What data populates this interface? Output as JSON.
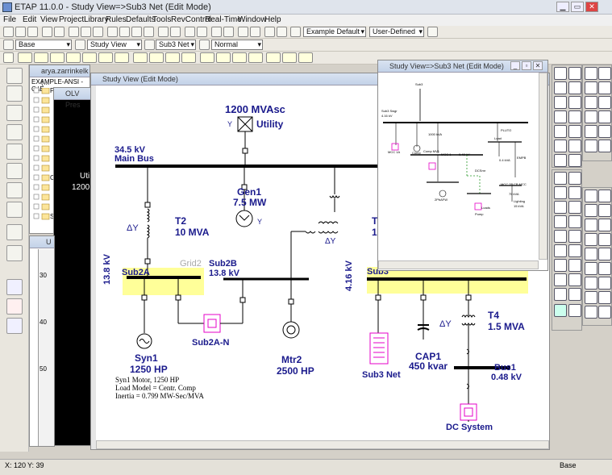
{
  "app": {
    "title": "ETAP 11.0.0 - Study View=>Sub3 Net (Edit Mode)"
  },
  "menu": [
    "File",
    "Edit",
    "View",
    "Project",
    "Library",
    "Rules",
    "Defaults",
    "Tools",
    "RevControl",
    "Real-Time",
    "Window",
    "Help"
  ],
  "toolbar": {
    "example_combo": "Example Default",
    "user_combo": "User-Defined",
    "base_combo": "Base",
    "studyview_combo": "Study View",
    "sub3_combo": "Sub3 Net",
    "normal_combo": "Normal"
  },
  "project_tree": {
    "title": "arya.zarrinkelk (...",
    "root": "EXAMPLE-ANSI - C:\\E",
    "items": [
      "Pres",
      "",
      "",
      "",
      "",
      "",
      "",
      "",
      "",
      "Con",
      "",
      "",
      "",
      "Stu"
    ]
  },
  "olv": {
    "title": "OLV Pres",
    "labels": [
      "Uti",
      "1200"
    ]
  },
  "u_window": {
    "title": "U",
    "ruler": [
      "30",
      "40",
      "50"
    ]
  },
  "main_view": {
    "title": "Study View (Edit Mode)",
    "utility": {
      "rating": "1200 MVAsc",
      "name": "Utility",
      "conn": "Y"
    },
    "main_bus": {
      "voltage": "34.5 kV",
      "name": "Main Bus"
    },
    "t2": {
      "conn": "ΔY",
      "name": "T2",
      "rating": "10 MVA"
    },
    "gen1": {
      "name": "Gen1",
      "rating": "7.5 MW",
      "conn": "Y"
    },
    "t3": {
      "conn": "Y",
      "conn2": "ΔY",
      "name": "T",
      "rating": "1"
    },
    "sub2a": {
      "voltage": "13.8 kV",
      "name": "Sub2A",
      "grid": "Grid2"
    },
    "sub2b": {
      "name": "Sub2B",
      "voltage": "13.8 kV"
    },
    "sub3": {
      "voltage": "4.16 kV",
      "name": "Sub3"
    },
    "syn1": {
      "name": "Syn1",
      "rating": "1250 HP",
      "info": [
        "Syn1 Motor, 1250 HP",
        "Load Model = Centr. Comp",
        "Inertia = 0.799 MW-Sec/MVA"
      ]
    },
    "sub2a_n": {
      "name": "Sub2A-N"
    },
    "mtr2": {
      "name": "Mtr2",
      "rating": "2500 HP"
    },
    "sub3_net": {
      "name": "Sub3 Net"
    },
    "cap1": {
      "name": "CAP1",
      "rating": "450 kvar"
    },
    "t4": {
      "conn": "ΔY",
      "name": "T4",
      "rating": "1.5 MVA"
    },
    "bus1": {
      "name": "Bus1",
      "voltage": "0.48 kV"
    },
    "dc": {
      "name": "DC System"
    }
  },
  "sub3_window": {
    "title": "Study View=>Sub3 Net (Edit Mode)",
    "labels": [
      "Sub3",
      "Sub3 Swgr",
      "4.16 kV",
      "MCC 1A",
      "Comp MV1",
      "Comp",
      "1000 kVA",
      "MCC 1",
      "0.48 kV",
      "Load",
      "PLUTO",
      "0.4 kVA",
      "DCSmr",
      "EMPB",
      "2PbAFW",
      "Pump",
      "MCC 2B",
      "CB MCC",
      "75 kVA",
      "Lighting",
      "15 kVA",
      "Loads"
    ]
  },
  "status": {
    "x": "X: 120",
    "y": "Y: 39",
    "mode": "Base"
  },
  "colors": {
    "bus_highlight": "#ffff99",
    "net_magenta": "#e600c8",
    "label_blue": "#1a1a8c"
  }
}
